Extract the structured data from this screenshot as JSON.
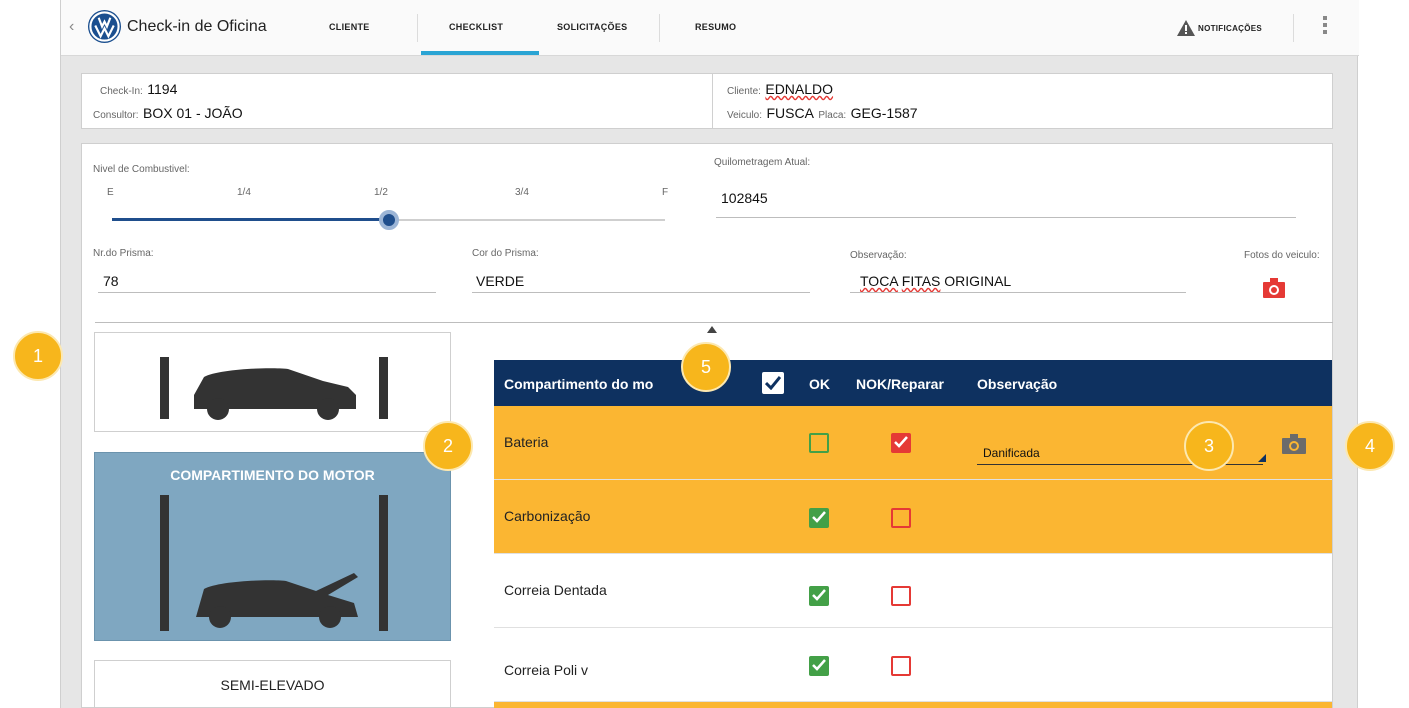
{
  "app": {
    "title": "Check-in de Oficina",
    "tabs": [
      {
        "label": "CLIENTE"
      },
      {
        "label": "CHECKLIST"
      },
      {
        "label": "SOLICITAÇÕES"
      },
      {
        "label": "RESUMO"
      }
    ],
    "active_tab": "CHECKLIST",
    "notifications_label": "NOTIFICAÇÕES",
    "accent_color": "#2aa4d4"
  },
  "info": {
    "checkin_label": "Check-In:",
    "checkin_value": "1194",
    "consultor_label": "Consultor:",
    "consultor_value": "BOX 01 - JOÃO",
    "cliente_label": "Cliente:",
    "cliente_value": "EDNALDO",
    "veiculo_label": "Veiculo:",
    "veiculo_value": "FUSCA",
    "placa_label": "Placa:",
    "placa_value": "GEG-1587"
  },
  "form": {
    "fuel_label": "Nivel de Combustivel:",
    "fuel_ticks": [
      "E",
      "1/4",
      "1/2",
      "3/4",
      "F"
    ],
    "fuel_level": 0.5,
    "km_label": "Quilometragem Atual:",
    "km_value": "102845",
    "prisma_label": "Nr.do Prisma:",
    "prisma_value": "78",
    "cor_label": "Cor do Prisma:",
    "cor_value": "VERDE",
    "obs_label": "Observação:",
    "obs_value_1": "TOCA",
    "obs_value_2": "FITAS",
    "obs_value_3": "ORIGINAL",
    "fotos_label": "Fotos do veiculo:"
  },
  "sections": {
    "selected_label": "COMPARTIMENTO DO MOTOR",
    "next_label": "SEMI-ELEVADO"
  },
  "table": {
    "header": {
      "col_item": "Compartimento do mo",
      "col_ok": "OK",
      "col_nok": "NOK/Reparar",
      "col_obs": "Observação"
    },
    "rows": [
      {
        "label": "Bateria",
        "ok": false,
        "nok": true,
        "highlight": true,
        "observation": "Danificada"
      },
      {
        "label": "Carbonização",
        "ok": true,
        "nok": false,
        "highlight": true
      },
      {
        "label": "Correia Dentada",
        "ok": true,
        "nok": false,
        "highlight": false
      },
      {
        "label": "Correia Poli v",
        "ok": true,
        "nok": false,
        "highlight": false
      }
    ],
    "highlight_color": "#fbb632",
    "header_color": "#0e3160"
  },
  "badges": [
    "1",
    "2",
    "3",
    "4",
    "5"
  ]
}
